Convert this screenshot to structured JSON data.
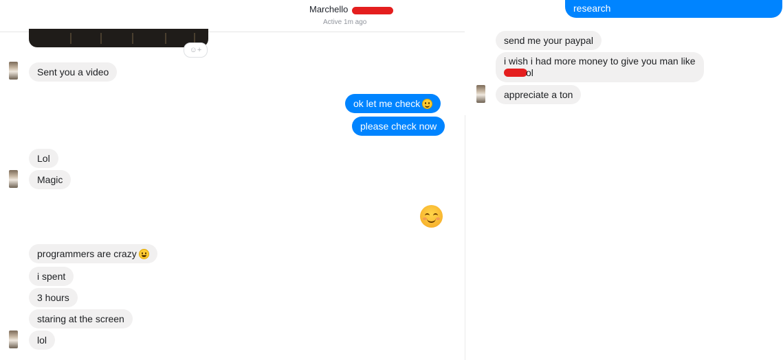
{
  "header": {
    "name": "Marchello",
    "status": "Active 1m ago"
  },
  "left_chat": {
    "messages": [
      {
        "from": "them",
        "text": "Sent you a video"
      },
      {
        "from": "me",
        "text": "ok let me check",
        "emoji": "slightly-smiling-emoji"
      },
      {
        "from": "me",
        "text": "please check now"
      },
      {
        "from": "them",
        "text": "Lol"
      },
      {
        "from": "them",
        "text": "Magic"
      },
      {
        "from": "me",
        "emoji": "smiling-face-emoji"
      },
      {
        "from": "them",
        "text": "programmers are crazy",
        "emoji": "grinning-emoji"
      },
      {
        "from": "them",
        "text": "i spent"
      },
      {
        "from": "them",
        "text": "3 hours"
      },
      {
        "from": "them",
        "text": "staring at the screen"
      },
      {
        "from": "them",
        "text": "lol"
      }
    ]
  },
  "right_chat": {
    "messages": [
      {
        "from": "me",
        "text": "research"
      },
      {
        "from": "them",
        "text": "send me your paypal"
      },
      {
        "from": "them",
        "text_line1": "i wish i had more money to give you man like",
        "text_line2": "ol"
      },
      {
        "from": "them",
        "text": "appreciate a ton"
      }
    ]
  },
  "colors": {
    "outgoing": "#0084ff",
    "incoming": "#f1f0f0",
    "redaction": "#e41e1e"
  }
}
